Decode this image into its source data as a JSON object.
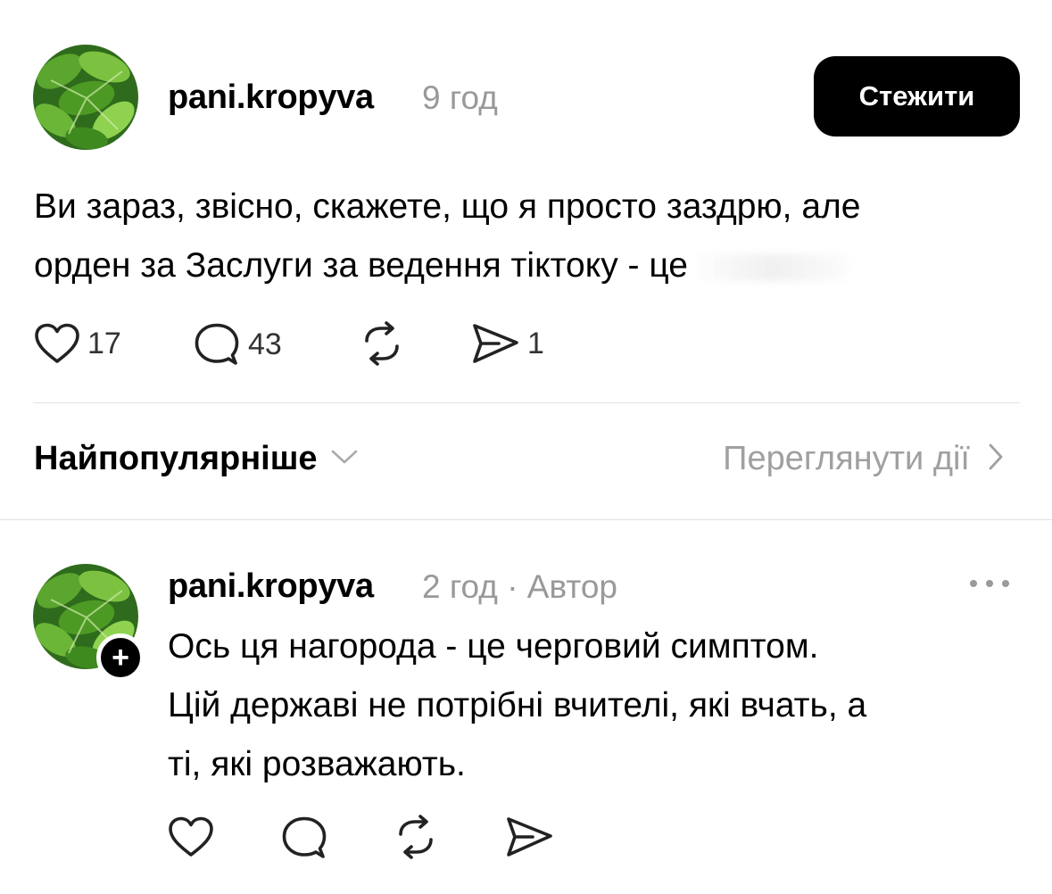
{
  "post": {
    "username": "pani.kropyva",
    "time": "9 год",
    "follow_label": "Стежити",
    "text_line1": "Ви зараз, звісно, скажете, що я просто заздрю, але",
    "text_line2": "орден за Заслуги за ведення тіктоку - це",
    "likes": "17",
    "comments": "43",
    "shares": "1"
  },
  "comments_header": {
    "sort_label": "Найпопулярніше",
    "view_activity_label": "Переглянути дії"
  },
  "reply": {
    "username": "pani.kropyva",
    "time": "2 год",
    "separator": "·",
    "author_badge": "Автор",
    "plus": "+",
    "text_line1": "Ось ця нагорода - це черговий симптом.",
    "text_line2": "Цій державі не потрібні вчителі, які вчать, а",
    "text_line3": "ті, які розважають."
  },
  "icons": {
    "heart": "heart-icon",
    "comment": "comment-icon",
    "repost": "repost-icon",
    "share": "share-icon",
    "chevron_down": "chevron-down-icon",
    "chevron_right": "chevron-right-icon",
    "more": "more-icon"
  },
  "colors": {
    "text": "#000000",
    "muted": "#999999",
    "button_bg": "#000000",
    "button_text": "#ffffff",
    "divider": "#e2e2e2"
  }
}
